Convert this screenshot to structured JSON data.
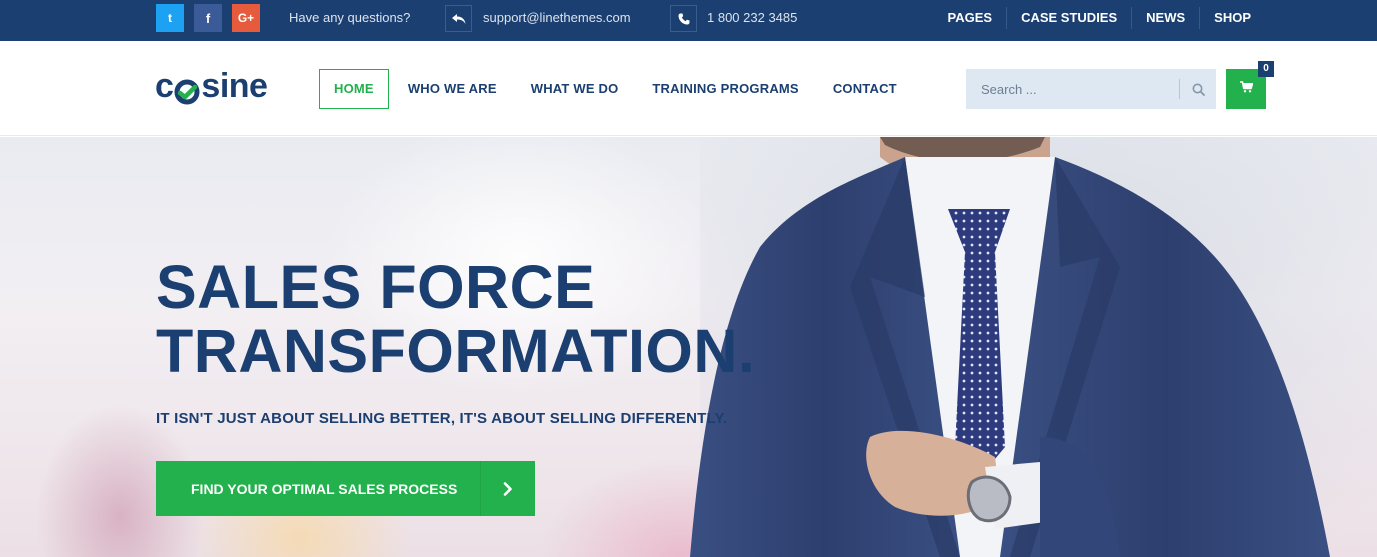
{
  "topbar": {
    "social": [
      {
        "name": "twitter-icon",
        "glyph": "t"
      },
      {
        "name": "facebook-icon",
        "glyph": "f"
      },
      {
        "name": "google-plus-icon",
        "glyph": "G+"
      }
    ],
    "question_text": "Have any questions?",
    "email": "support@linethemes.com",
    "phone": "1 800 232 3485",
    "menu": [
      "PAGES",
      "CASE STUDIES",
      "NEWS",
      "SHOP"
    ]
  },
  "header": {
    "logo_left": "c",
    "logo_right": "sine",
    "nav": [
      "HOME",
      "WHO WE ARE",
      "WHAT WE DO",
      "TRAINING PROGRAMS",
      "CONTACT"
    ],
    "active_nav": "HOME",
    "search_placeholder": "Search ...",
    "cart_count": "0"
  },
  "hero": {
    "title_line1": "SALES FORCE",
    "title_line2": "TRANSFORMATION",
    "title_dot": ".",
    "subtitle": "IT ISN'T JUST ABOUT SELLING BETTER, IT'S ABOUT SELLING DIFFERENTLY.",
    "cta_label": "FIND YOUR OPTIMAL SALES PROCESS"
  },
  "colors": {
    "brand_navy": "#1b3f70",
    "accent_green": "#22b14c",
    "twitter": "#1da1f2",
    "facebook": "#3b5b98",
    "google_plus": "#e65b3b"
  }
}
